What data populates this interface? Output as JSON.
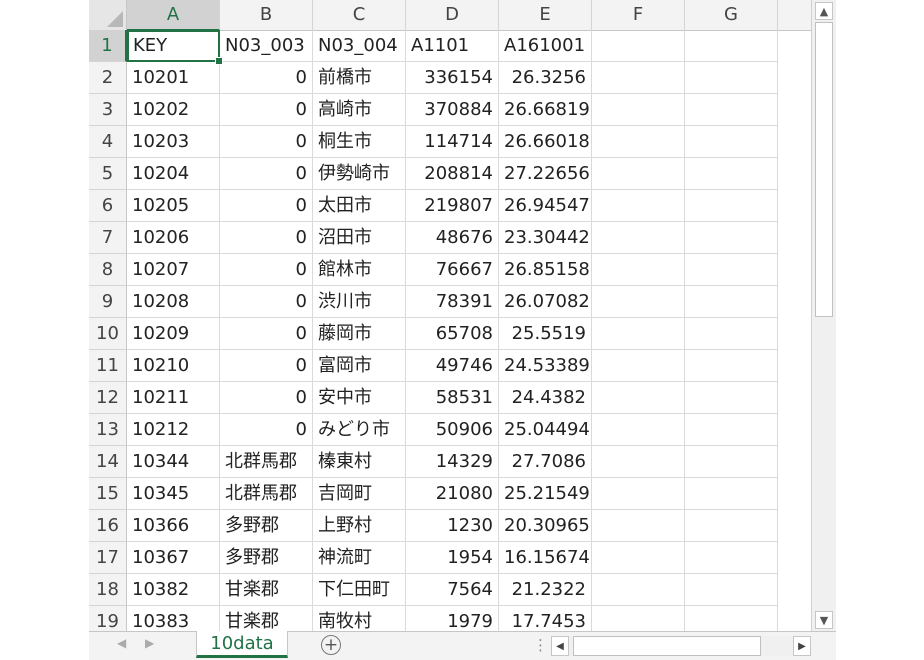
{
  "sheet": {
    "columns": [
      "A",
      "B",
      "C",
      "D",
      "E",
      "F",
      "G"
    ],
    "selected_column": "A",
    "selected_row": "1",
    "rows": [
      {
        "n": "1",
        "a": "KEY",
        "b": "N03_003",
        "c": "N03_004",
        "d": "A1101",
        "e": "A161001"
      },
      {
        "n": "2",
        "a": "10201",
        "b": "0",
        "c": "前橋市",
        "d": "336154",
        "e": "26.3256"
      },
      {
        "n": "3",
        "a": "10202",
        "b": "0",
        "c": "高崎市",
        "d": "370884",
        "e": "26.66819"
      },
      {
        "n": "4",
        "a": "10203",
        "b": "0",
        "c": "桐生市",
        "d": "114714",
        "e": "26.66018"
      },
      {
        "n": "5",
        "a": "10204",
        "b": "0",
        "c": "伊勢崎市",
        "d": "208814",
        "e": "27.22656"
      },
      {
        "n": "6",
        "a": "10205",
        "b": "0",
        "c": "太田市",
        "d": "219807",
        "e": "26.94547"
      },
      {
        "n": "7",
        "a": "10206",
        "b": "0",
        "c": "沼田市",
        "d": "48676",
        "e": "23.30442"
      },
      {
        "n": "8",
        "a": "10207",
        "b": "0",
        "c": "館林市",
        "d": "76667",
        "e": "26.85158"
      },
      {
        "n": "9",
        "a": "10208",
        "b": "0",
        "c": "渋川市",
        "d": "78391",
        "e": "26.07082"
      },
      {
        "n": "10",
        "a": "10209",
        "b": "0",
        "c": "藤岡市",
        "d": "65708",
        "e": "25.5519"
      },
      {
        "n": "11",
        "a": "10210",
        "b": "0",
        "c": "富岡市",
        "d": "49746",
        "e": "24.53389"
      },
      {
        "n": "12",
        "a": "10211",
        "b": "0",
        "c": "安中市",
        "d": "58531",
        "e": "24.4382"
      },
      {
        "n": "13",
        "a": "10212",
        "b": "0",
        "c": "みどり市",
        "d": "50906",
        "e": "25.04494"
      },
      {
        "n": "14",
        "a": "10344",
        "b": "北群馬郡",
        "c": "榛東村",
        "d": "14329",
        "e": "27.7086"
      },
      {
        "n": "15",
        "a": "10345",
        "b": "北群馬郡",
        "c": "吉岡町",
        "d": "21080",
        "e": "25.21549"
      },
      {
        "n": "16",
        "a": "10366",
        "b": "多野郡",
        "c": "上野村",
        "d": "1230",
        "e": "20.30965"
      },
      {
        "n": "17",
        "a": "10367",
        "b": "多野郡",
        "c": "神流町",
        "d": "1954",
        "e": "16.15674"
      },
      {
        "n": "18",
        "a": "10382",
        "b": "甘楽郡",
        "c": "下仁田町",
        "d": "7564",
        "e": "21.2322"
      },
      {
        "n": "19",
        "a": "10383",
        "b": "甘楽郡",
        "c": "南牧村",
        "d": "1979",
        "e": "17.7453"
      }
    ]
  },
  "tabs": {
    "active": "10data"
  },
  "icons": {
    "scroll_up": "▲",
    "scroll_down": "▼",
    "scroll_left": "◀",
    "scroll_right": "▶",
    "prev_sheet": "◀",
    "next_sheet": "▶",
    "add_sheet": "+",
    "splitter": "⋮"
  },
  "colors": {
    "accent": "#217346"
  }
}
